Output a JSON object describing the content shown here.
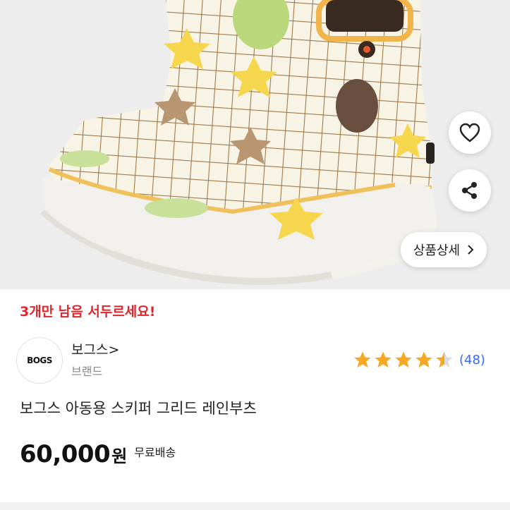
{
  "hero": {
    "image_name": "product-boots-image",
    "brand_mark": "BOGS"
  },
  "actions": {
    "wishlist_icon": "heart-icon",
    "share_icon": "share-icon",
    "detail_label": "상품상세",
    "detail_icon": "chevron-right-icon"
  },
  "stock_notice": "3개만 남음 서두르세요!",
  "brand": {
    "logo_text": "BOGS",
    "name": "보그스>",
    "label": "브랜드"
  },
  "rating": {
    "stars": 4.5,
    "count_text": "(48)",
    "star_color": "#f7a823"
  },
  "product": {
    "title": "보그스 아동용 스키퍼 그리드 레인부츠"
  },
  "price": {
    "amount": "60,000",
    "unit": "원",
    "shipping": "무료배송"
  },
  "colors": {
    "stock_red": "#e0262d",
    "link_blue": "#346aff"
  }
}
